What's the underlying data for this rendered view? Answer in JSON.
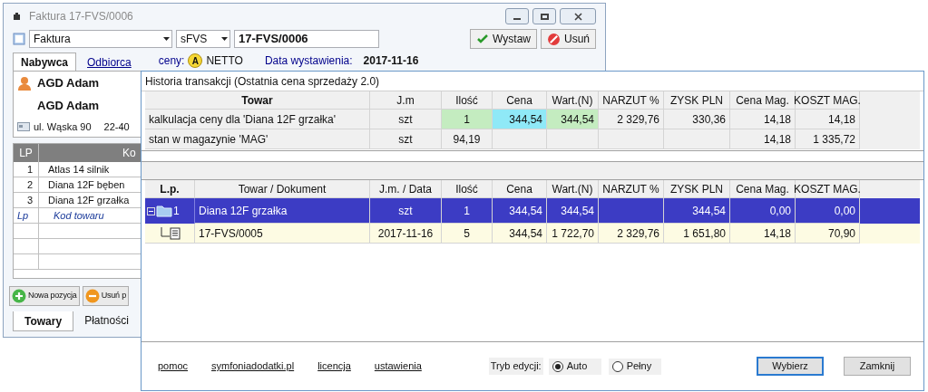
{
  "invoice_window": {
    "title": "Faktura 17-FVS/0006",
    "doc_type": "Faktura",
    "series": "sFVS",
    "number": "17-FVS/0006",
    "buttons": [
      {
        "kind": "check",
        "label": "Wystaw"
      },
      {
        "kind": "delete",
        "label": "Usuń"
      }
    ],
    "tabs": [
      {
        "label": "Nabywca",
        "selected": true
      },
      {
        "label": "Odbiorca",
        "selected": false
      }
    ],
    "prices_label": "ceny:",
    "prices_badge": "A",
    "prices_mode": "NETTO",
    "date_label": "Data wystawienia:",
    "date": "2017-11-16",
    "buyer": {
      "name": "AGD Adam",
      "full_name": "AGD Adam",
      "street": "ul. Wąska 90",
      "postal": "22-40"
    },
    "table": {
      "columns": [
        "LP",
        "Ko"
      ],
      "rows": [
        [
          "1",
          "Atlas 14 silnik"
        ],
        [
          "2",
          "Diana 12F bęben"
        ],
        [
          "3",
          "Diana 12F grzałka"
        ]
      ],
      "new_row": [
        "Lp",
        "Kod towaru"
      ]
    },
    "actions": [
      {
        "kind": "add",
        "label": "Nowa pozycja"
      },
      {
        "kind": "remove",
        "label": "Usuń p"
      }
    ],
    "bottom_tabs": [
      {
        "label": "Towary",
        "selected": true
      },
      {
        "label": "Płatności",
        "selected": false
      }
    ]
  },
  "history": {
    "title": "Historia transakcji (Ostatnia cena sprzedaży 2.0)",
    "summary": {
      "columns": [
        "Towar",
        "J.m",
        "Ilość",
        "Cena",
        "Wart.(N)",
        "NARZUT %",
        "ZYSK PLN",
        "Cena Mag.",
        "KOSZT MAG."
      ],
      "rows": [
        [
          {
            "text": "kalkulacja ceny dla 'Diana 12F grzałka'"
          },
          {
            "text": "szt"
          },
          {
            "text": "1",
            "color": "#c4ecc0"
          },
          {
            "text": "344,54",
            "color": "#8fe9f7"
          },
          {
            "text": "344,54",
            "color": "#c4ecc0"
          },
          {
            "text": "2 329,76"
          },
          {
            "text": "330,36"
          },
          {
            "text": "14,18"
          },
          {
            "text": "14,18"
          }
        ],
        [
          {
            "text": "stan w magazynie 'MAG'"
          },
          {
            "text": "szt"
          },
          {
            "text": "94,19"
          },
          {},
          {},
          {},
          {},
          {
            "text": "14,18"
          },
          {
            "text": "1 335,72"
          }
        ]
      ]
    },
    "transactions": {
      "columns": [
        "L.p.",
        "Towar / Dokument",
        "J.m. / Data",
        "Ilość",
        "Cena",
        "Wart.(N)",
        "NARZUT %",
        "ZYSK PLN",
        "Cena Mag.",
        "KOSZT MAG."
      ],
      "rows": [
        {
          "lp": "1",
          "name": "Diana 12F grzałka",
          "unit": "szt",
          "values": {
            "qty": "1",
            "price": "344,54",
            "value": "344,54",
            "profit": "344,54",
            "stock_price": "0,00",
            "stock_cost": "0,00"
          },
          "selected": true,
          "expanded": true,
          "children": [
            {
              "name": "17-FVS/0005",
              "unit": "2017-11-16",
              "values": {
                "qty": "5",
                "price": "344,54",
                "value": "1 722,70",
                "markup": "2 329,76",
                "profit": "1 651,80",
                "stock_price": "14,18",
                "stock_cost": "70,90"
              },
              "selected": false
            }
          ]
        }
      ]
    },
    "links": [
      "pomoc",
      "symfoniadodatki.pl",
      "licencja",
      "ustawienia"
    ],
    "mode_label": "Tryb edycji:",
    "modes": [
      {
        "label": "Auto",
        "selected": true
      },
      {
        "label": "Pełny",
        "selected": false
      }
    ],
    "buttons": [
      {
        "label": "Wybierz",
        "default": true
      },
      {
        "label": "Zamknij",
        "default": false
      }
    ]
  }
}
